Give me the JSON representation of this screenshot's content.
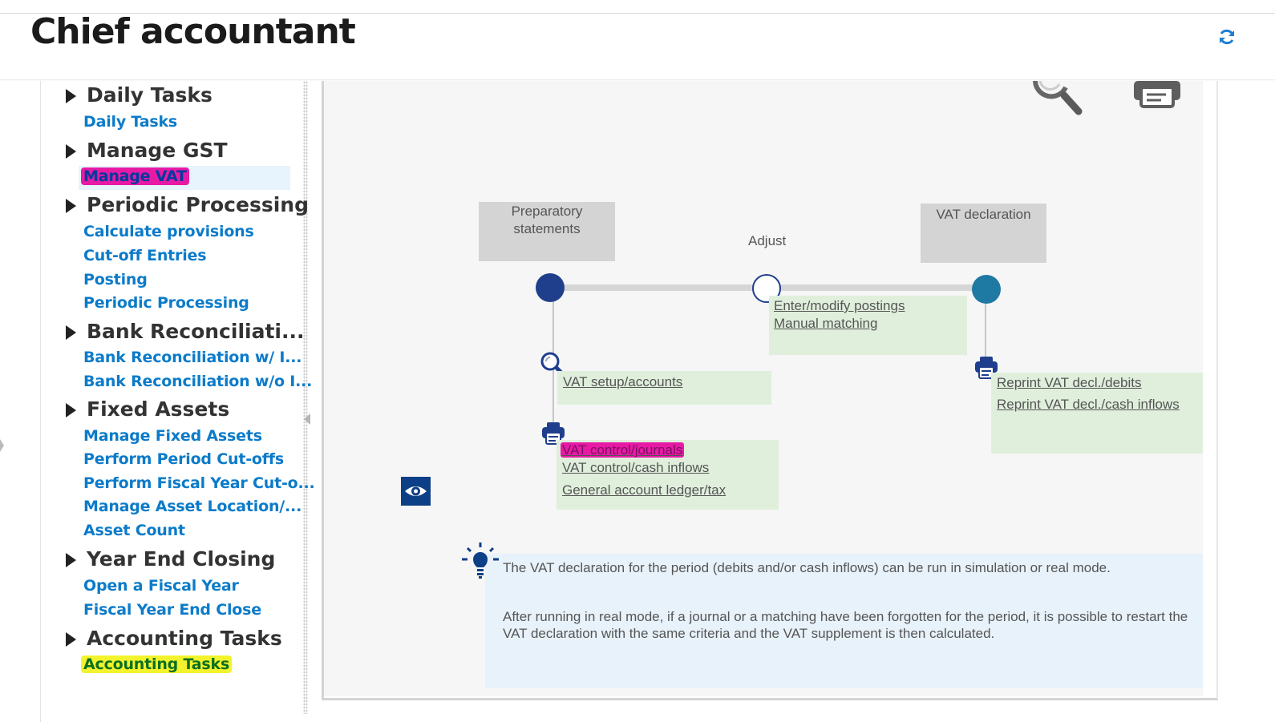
{
  "header": {
    "title": "Chief accountant",
    "refresh_icon": "refresh-icon"
  },
  "sidebar": {
    "sections": [
      {
        "title": "Daily Tasks",
        "links": [
          "Daily Tasks"
        ]
      },
      {
        "title": "Manage GST",
        "links": [
          "Manage VAT"
        ]
      },
      {
        "title": "Periodic Processing",
        "links": [
          "Calculate provisions",
          "Cut-off Entries",
          "Posting",
          "Periodic Processing"
        ]
      },
      {
        "title": "Bank Reconciliati...",
        "links": [
          "Bank Reconciliation w/ I...",
          "Bank Reconciliation w/o I..."
        ]
      },
      {
        "title": "Fixed Assets",
        "links": [
          "Manage Fixed Assets",
          "Perform Period Cut-offs",
          "Perform Fiscal Year Cut-o...",
          "Manage Asset Location/...",
          "Asset Count"
        ]
      },
      {
        "title": "Year End Closing",
        "links": [
          "Open a Fiscal Year",
          "Fiscal Year End Close"
        ]
      },
      {
        "title": "Accounting Tasks",
        "links": [
          "Accounting Tasks"
        ]
      }
    ],
    "selected_link": "Manage VAT",
    "highlight_colors": {
      "pink": "#e71aa6",
      "yellow": "#f3f32d"
    }
  },
  "diagram": {
    "toolbar_icons": [
      "search-icon",
      "print-icon"
    ],
    "steps": [
      {
        "label": "Preparatory statements",
        "dot_color": "#1f3e8c"
      },
      {
        "label": "Adjust",
        "dot_color": "#ffffff"
      },
      {
        "label": "VAT declaration",
        "dot_color": "#1e79a3"
      }
    ],
    "adjust_links": [
      "Enter/modify postings",
      "Manual matching"
    ],
    "setup_links": [
      "VAT setup/accounts"
    ],
    "control_links": [
      "VAT control/journals",
      "VAT control/cash inflows",
      "General account ledger/tax"
    ],
    "reprint_links": [
      "Reprint VAT decl./debits",
      "Reprint VAT decl./cash inflows"
    ],
    "info": {
      "line1": "The VAT declaration for the period (debits and/or cash inflows) can be run in simulation or real mode.",
      "line2": "After running in real mode, if a journal or a matching have been forgotten for the period, it is possible to restart the VAT declaration with the same criteria and the VAT supplement is then calculated."
    },
    "accent_color": "#0d3f86"
  }
}
